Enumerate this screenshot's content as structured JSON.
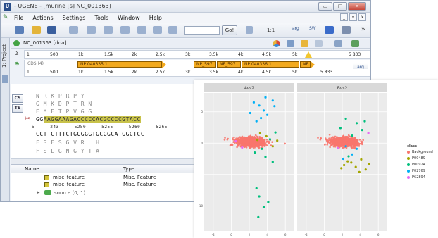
{
  "window": {
    "app_icon_text": "U",
    "title": "- UGENE - [murine [s] NC_001363]",
    "controls": {
      "minimize": "▭",
      "maximize": "□",
      "close": "✕"
    },
    "mdi_controls": {
      "minimize": "_",
      "restore": "▫",
      "close": "x"
    }
  },
  "menu": [
    "File",
    "Actions",
    "Settings",
    "Tools",
    "Window",
    "Help"
  ],
  "toolbar": {
    "go_label": "Go!",
    "zoom_text": "1:1",
    "more": "»",
    "small_labels": [
      "SW",
      "arg"
    ]
  },
  "sidebar": {
    "project_tab": "1: Project"
  },
  "sequence": {
    "name": "NC_001363 [dna]",
    "overview_ticks": [
      "1",
      "500",
      "1k",
      "1.5k",
      "2k",
      "2.5k",
      "3k",
      "3.5k",
      "4k",
      "4.5k",
      "5k",
      "5 833"
    ],
    "cds_label": "CDS (4)",
    "features": [
      {
        "label": "NP 040335.1"
      },
      {
        "label": "NP_597"
      },
      {
        "label": "NP_597"
      },
      {
        "label": "NP 040336.1"
      },
      {
        "label": "NP"
      }
    ],
    "position_ticks": [
      "1",
      "500",
      "1k",
      "1.5k",
      "2k",
      "2.5k",
      "3k",
      "3.5k",
      "4k",
      "4.5k",
      "5k",
      "5 833"
    ],
    "arg_button": "arg"
  },
  "detail": {
    "buttons": [
      "CS",
      "TS"
    ],
    "amino_top": "N  R  K  P  R  P  Y",
    "amino_mid": "G  M  K  D  P  T  R  N",
    "amino_low": "E  *  E  T  P  V  G  G",
    "sequence_prefix": "GG",
    "sequence_highlight": "AAGGAAAGACCCCCACGCCCCGTACC",
    "positions": [
      "5 243",
      "5250",
      "5255",
      "5260",
      "5265"
    ],
    "complement": "CCTTCTTTCTGGGGGTGCGGCATGGCTCC",
    "amino_c1": "F  S  F  S  G  V  R  L  H",
    "amino_c2": "F  S  L  G  N  G  Y  T  A"
  },
  "annotations": {
    "col_name": "Name",
    "col_type": "Type",
    "rows": [
      {
        "name": "misc_feature",
        "type": "Misc. Feature"
      },
      {
        "name": "misc_feature",
        "type": "Misc. Feature"
      }
    ],
    "source": "source  (0, 1)"
  },
  "colors": {
    "feature_orange": "#f2a91e",
    "background_points": "#f8766d",
    "P00489": "#a3a500",
    "P00924": "#00bf7d",
    "P02769": "#00b0f6",
    "P62894": "#e76bf3"
  },
  "chart_data": {
    "type": "scatter",
    "panels": [
      "Avs2",
      "Bvs2"
    ],
    "legend_title": "class",
    "legend": [
      "Background",
      "P00489",
      "P00924",
      "P02769",
      "P62894"
    ],
    "xticks": [
      "-2",
      "0",
      "2",
      "4",
      "6"
    ],
    "xlim": [
      -3,
      7
    ],
    "ylim": [
      -14,
      8
    ],
    "highlight_points": {
      "Avs2": {
        "P02769": [
          [
            2.5,
            6.5
          ],
          [
            3.1,
            6.0
          ],
          [
            3.6,
            5.2
          ],
          [
            4.0,
            4.5
          ],
          [
            4.6,
            6.8
          ],
          [
            3.3,
            4.0
          ],
          [
            4.8,
            5.9
          ],
          [
            2.1,
            4.8
          ],
          [
            3.8,
            7.3
          ],
          [
            2.8,
            3.5
          ]
        ],
        "P00924": [
          [
            4.3,
            0.6
          ],
          [
            3.4,
            -0.9
          ],
          [
            4.9,
            1.7
          ],
          [
            2.6,
            -1.5
          ],
          [
            3.8,
            -2.2
          ],
          [
            4.6,
            -3.0
          ],
          [
            3.1,
            -8.5
          ],
          [
            3.6,
            -10.2
          ],
          [
            3.0,
            -11.8
          ],
          [
            4.1,
            -9.4
          ],
          [
            2.8,
            -7.2
          ]
        ],
        "P00489": [
          [
            3.9,
            1.1
          ],
          [
            4.6,
            -0.5
          ],
          [
            5.1,
            0.4
          ],
          [
            3.2,
            1.6
          ],
          [
            2.9,
            0.5
          ]
        ],
        "P62894": [
          [
            0.5,
            0.3
          ],
          [
            1.2,
            -0.7
          ]
        ]
      },
      "Bvs2": {
        "P02769": [
          [
            2.4,
            -0.5
          ],
          [
            3.1,
            -1.8
          ],
          [
            2.1,
            -2.5
          ],
          [
            3.6,
            -0.9
          ]
        ],
        "P00924": [
          [
            3.6,
            3.2
          ],
          [
            4.2,
            2.1
          ],
          [
            3.1,
            1.2
          ],
          [
            4.5,
            3.5
          ],
          [
            2.4,
            3.9
          ],
          [
            1.8,
            2.4
          ],
          [
            2.7,
            -2.1
          ]
        ],
        "P00489": [
          [
            3.0,
            -3.1
          ],
          [
            3.5,
            -3.8
          ],
          [
            4.1,
            -2.6
          ],
          [
            4.6,
            -4.2
          ],
          [
            2.6,
            -2.9
          ],
          [
            3.9,
            -4.6
          ],
          [
            2.2,
            -3.5
          ],
          [
            5.0,
            -3.3
          ],
          [
            1.9,
            -4.0
          ]
        ],
        "P62894": [
          [
            4.9,
            1.6
          ],
          [
            1.5,
            -0.8
          ]
        ]
      }
    }
  }
}
